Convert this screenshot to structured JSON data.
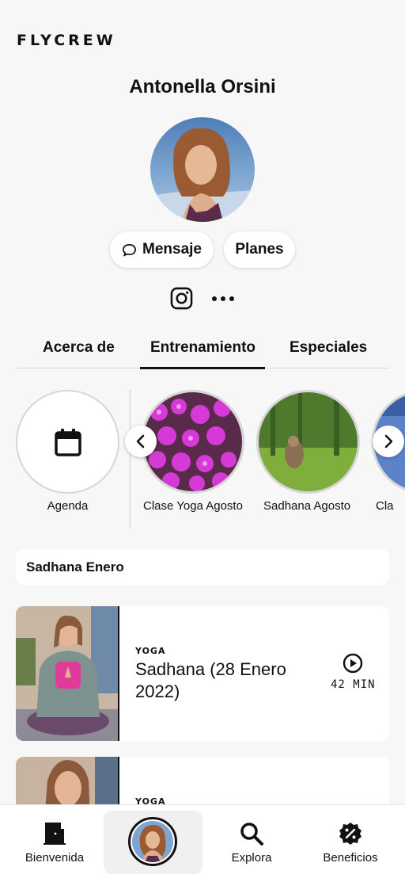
{
  "app": {
    "logo": "FLYCREW"
  },
  "profile": {
    "name": "Antonella Orsini",
    "message_label": "Mensaje",
    "plans_label": "Planes"
  },
  "tabs": [
    {
      "label": "Acerca de",
      "active": false
    },
    {
      "label": "Entrenamiento",
      "active": true
    },
    {
      "label": "Especiales",
      "active": false
    }
  ],
  "stories": {
    "agenda_label": "Agenda",
    "items": [
      {
        "label": "Clase Yoga Agosto"
      },
      {
        "label": "Sadhana Agosto"
      },
      {
        "label": "Cla"
      }
    ]
  },
  "section": {
    "title": "Sadhana Enero"
  },
  "classes": [
    {
      "category": "YOGA",
      "title": "Sadhana (28 Enero 2022)",
      "duration": "42 MIN"
    },
    {
      "category": "YOGA",
      "title": "",
      "duration": ""
    }
  ],
  "bottom_nav": {
    "items": [
      {
        "label": "Bienvenida",
        "icon": "door-icon"
      },
      {
        "label": "",
        "icon": "profile-avatar"
      },
      {
        "label": "Explora",
        "icon": "search-icon"
      },
      {
        "label": "Beneficios",
        "icon": "discount-badge-icon"
      }
    ]
  },
  "colors": {
    "background": "#f7f7f7",
    "card": "#ffffff",
    "text": "#111111",
    "divider": "#d6d6d6"
  }
}
